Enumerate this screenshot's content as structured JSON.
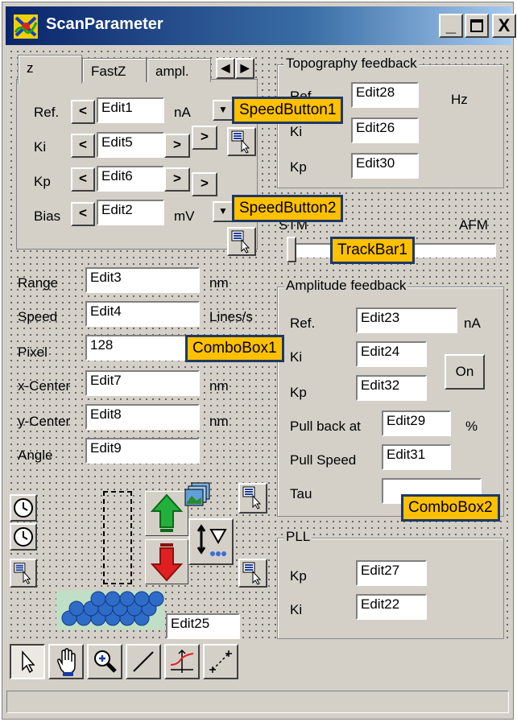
{
  "window": {
    "title": "ScanParameter",
    "minimize": "_",
    "close": "X"
  },
  "tabs": [
    "z",
    "FastZ",
    "ampl."
  ],
  "z_panel": {
    "rows": [
      {
        "label": "Ref.",
        "value": "Edit1",
        "unit": "nA"
      },
      {
        "label": "Ki",
        "value": "Edit5",
        "unit": ""
      },
      {
        "label": "Kp",
        "value": "Edit6",
        "unit": ""
      },
      {
        "label": "Bias",
        "value": "Edit2",
        "unit": "mV"
      }
    ],
    "dec": "<",
    "inc": ">"
  },
  "topography": {
    "title": "Topography feedback",
    "rows": [
      {
        "label": "Ref.",
        "value": "Edit28"
      },
      {
        "label": "Ki",
        "value": "Edit26"
      },
      {
        "label": "Kp",
        "value": "Edit30"
      }
    ],
    "unit": "Hz"
  },
  "trackbar": {
    "left": "STM",
    "right": "AFM",
    "position": 0
  },
  "scan": {
    "rows": [
      {
        "label": "Range",
        "value": "Edit3",
        "unit": "nm"
      },
      {
        "label": "Speed",
        "value": "Edit4",
        "unit": "Lines/s"
      },
      {
        "label": "Pixel",
        "value": "128",
        "unit": ""
      },
      {
        "label": "x-Center",
        "value": "Edit7",
        "unit": "nm"
      },
      {
        "label": "y-Center",
        "value": "Edit8",
        "unit": "nm"
      },
      {
        "label": "Angle",
        "value": "Edit9",
        "unit": ""
      }
    ]
  },
  "amplitude": {
    "title": "Amplitude feedback",
    "ref": {
      "label": "Ref.",
      "value": "Edit23",
      "unit": "nA"
    },
    "ki": {
      "label": "Ki",
      "value": "Edit24"
    },
    "kp": {
      "label": "Kp",
      "value": "Edit32"
    },
    "on_button": "On",
    "pullback": {
      "label": "Pull back at",
      "value": "Edit29",
      "unit": "%"
    },
    "pullspeed": {
      "label": "Pull Speed",
      "value": "Edit31"
    },
    "tau": {
      "label": "Tau",
      "value": ""
    }
  },
  "pll": {
    "title": "PLL",
    "kp": {
      "label": "Kp",
      "value": "Edit27"
    },
    "ki": {
      "label": "Ki",
      "value": "Edit22"
    }
  },
  "edit25": "Edit25",
  "callouts": {
    "sb1": "SpeedButton1",
    "sb2": "SpeedButton2",
    "track": "TrackBar1",
    "combo1": "ComboBox1",
    "combo2": "ComboBox2"
  },
  "toolbar": [
    "select-arrow",
    "hand",
    "zoom",
    "line",
    "profile",
    "ruler"
  ]
}
